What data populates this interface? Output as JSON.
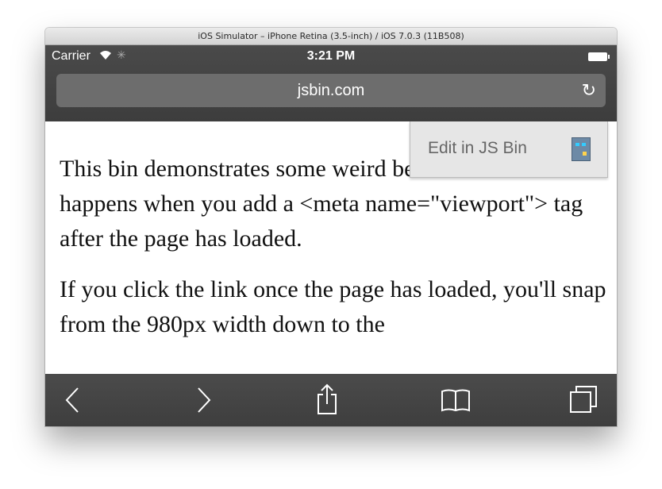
{
  "window": {
    "title": "iOS Simulator – iPhone Retina (3.5-inch) / iOS 7.0.3 (11B508)"
  },
  "status_bar": {
    "carrier": "Carrier",
    "wifi_icon": "wifi-icon",
    "activity_icon": "activity-spinner-icon",
    "time": "3:21 PM",
    "battery_icon": "battery-icon"
  },
  "browser": {
    "url": "jsbin.com",
    "reload_icon": "reload-icon"
  },
  "page": {
    "paragraphs": [
      "This bin demonstrates some weird behaviour that happens when you add a <meta name=\"viewport\"> tag after the page has loaded.",
      "If you click the link once the page has loaded, you'll snap from the 980px width down to the"
    ],
    "edit_button": {
      "label": "Edit in JS Bin",
      "icon": "jsbin-logo-icon"
    }
  },
  "toolbar": {
    "items": [
      "back-icon",
      "forward-icon",
      "share-icon",
      "bookmarks-icon",
      "tabs-icon"
    ]
  },
  "colors": {
    "chrome": "#3f3f3f",
    "url_field": "#6d6d6d",
    "edit_button_bg": "#e6e6e6"
  }
}
